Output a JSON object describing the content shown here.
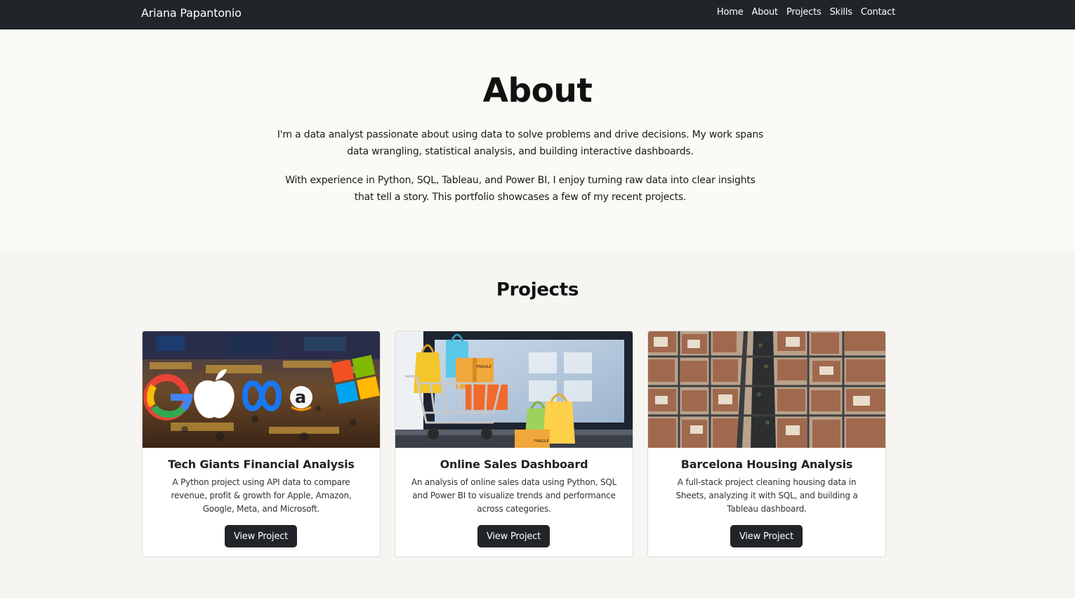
{
  "navbar": {
    "brand": "Ariana Papantonio",
    "links": [
      "Home",
      "About",
      "Projects",
      "Skills",
      "Contact"
    ]
  },
  "about": {
    "heading": "About",
    "paragraphs": [
      "I'm a data analyst passionate about using data to solve problems and drive decisions. My work spans data wrangling, statistical analysis, and building interactive dashboards.",
      "With experience in Python, SQL, Tableau, and Power BI, I enjoy turning raw data into clear insights that tell a story. This portfolio showcases a few of my recent projects."
    ]
  },
  "projects": {
    "heading": "Projects",
    "cards": [
      {
        "title": "Tech Giants Financial Analysis",
        "description": "A Python project using API data to compare revenue, profit & growth for Apple, Amazon, Google, Meta, and Microsoft.",
        "button": "View Project",
        "image": "stock-exchange-tech-logos-image"
      },
      {
        "title": "Online Sales Dashboard",
        "description": "An analysis of online sales data using Python, SQL and Power BI to visualize trends and performance across categories.",
        "button": "View Project",
        "image": "shopping-cart-laptop-image",
        "image_labels": [
          "FRAGILE",
          "FRAGILE"
        ]
      },
      {
        "title": "Barcelona Housing Analysis",
        "description": "A full-stack project cleaning housing data in Sheets, analyzing it with SQL, and building a Tableau dashboard.",
        "button": "View Project",
        "image": "barcelona-aerial-city-image"
      }
    ]
  },
  "colors": {
    "navbar_bg": "#212529",
    "about_bg": "#fbfbf5",
    "projects_bg": "#f6f5f1",
    "button_bg": "#212529"
  }
}
